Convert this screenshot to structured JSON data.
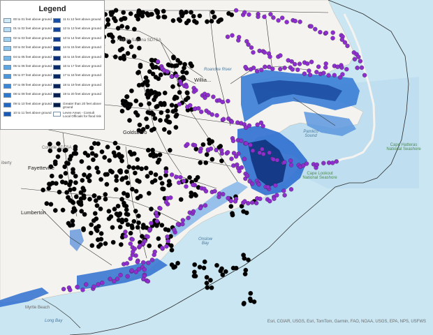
{
  "legend": {
    "title": "Legend",
    "items": [
      {
        "label": "00 to 01 feet above ground",
        "color": "#cfe9f7"
      },
      {
        "label": "01 to 02 feet above ground",
        "color": "#b6dcf3"
      },
      {
        "label": "02 to 03 feet above ground",
        "color": "#9fcfee"
      },
      {
        "label": "03 to 04 feet above ground",
        "color": "#89c2ea"
      },
      {
        "label": "04 to 05 feet above ground",
        "color": "#73b5e6"
      },
      {
        "label": "05 to 06 feet above ground",
        "color": "#5ea6e1"
      },
      {
        "label": "06 to 07 feet above ground",
        "color": "#4b97dc"
      },
      {
        "label": "07 to 08 feet above ground",
        "color": "#3a87d5"
      },
      {
        "label": "08 to 09 feet above ground",
        "color": "#2d78cc"
      },
      {
        "label": "09 to 10 feet above ground",
        "color": "#2268c1"
      },
      {
        "label": "10 to 11 feet above ground",
        "color": "#1a5ab5"
      },
      {
        "label": "11 to 12 feet above ground",
        "color": "#164ea9"
      },
      {
        "label": "12 to 13 feet above ground",
        "color": "#12449d"
      },
      {
        "label": "13 to 14 feet above ground",
        "color": "#103c91"
      },
      {
        "label": "14 to 15 feet above ground",
        "color": "#0e3585"
      },
      {
        "label": "15 to 16 feet above ground",
        "color": "#0d2f79"
      },
      {
        "label": "16 to 17 feet above ground",
        "color": "#0c2a6e"
      },
      {
        "label": "17 to 18 feet above ground",
        "color": "#0b2664"
      },
      {
        "label": "18 to 19 feet above ground",
        "color": "#0a225a"
      },
      {
        "label": "19 to 20 feet above ground",
        "color": "#091f52"
      },
      {
        "label": "Greater than 20 feet above ground",
        "color": "#081c4a"
      },
      {
        "label": "Levee Areas - Consult Local Officials for flood risk",
        "color": "#ffffff"
      }
    ]
  },
  "map_labels": {
    "halifax": "Halifax-Sapona SDTSA",
    "roanoke": "Roanoke River",
    "williamston": "Willia...",
    "goldsboro": "Goldsboro",
    "coharie": "Coharie SDTSA",
    "fayetteville": "Fayetteville",
    "liberty": "iberty",
    "lumberton": "Lumberton",
    "pamlico": "Pamlico Sound",
    "cape_hatteras": "Cape Hatteras National Seashore",
    "cape_lookout": "Cape Lookout National Seashore",
    "onslow": "Onslow Bay",
    "myrtle": "Myrtle Beach",
    "long_bay": "Long Bay"
  },
  "attribution": "Esri, CGIAR, USGS, Esri, TomTom, Garmin, FAO, NOAA, USGS, EPA, NPS, USFWS",
  "colors": {
    "ocean": "#c9e6f2",
    "land": "#f4f3ef",
    "county_border": "#3a3a3a",
    "black_point": "#000000",
    "purple_point": "#8f2ecf",
    "flood_dark": "#0d2f79",
    "flood_mid": "#2f6fd0",
    "flood_light": "#7fb4ea"
  },
  "icons": {
    "black_marker": "filled-circle",
    "purple_marker": "filled-circle"
  }
}
